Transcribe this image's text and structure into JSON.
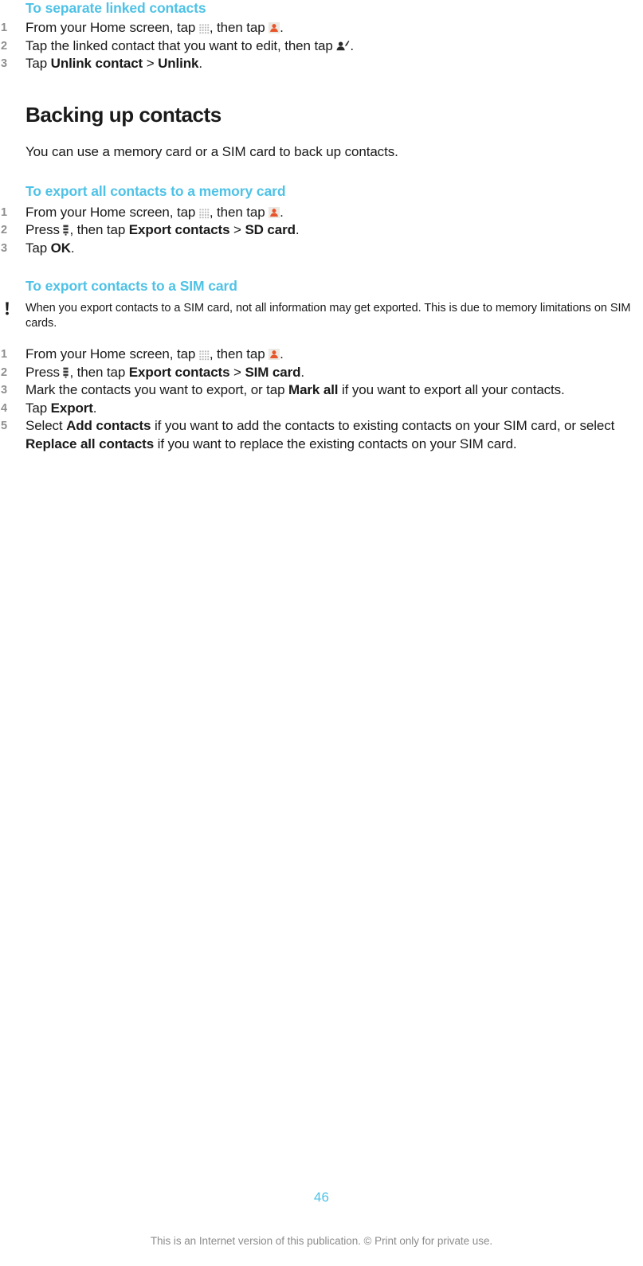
{
  "document": {
    "page_number": "46",
    "footer_text": "This is an Internet version of this publication. © Print only for private use.",
    "accent_color": "#4ec2e6",
    "text_color": "#1a1a1a",
    "number_color": "#8e8e8e"
  },
  "sections": [
    {
      "id": "separate-linked-contacts",
      "heading": "To separate linked contacts",
      "steps": [
        {
          "number": "1",
          "parts": [
            {
              "type": "text",
              "value": "From your Home screen, tap "
            },
            {
              "type": "icon",
              "name": "app-grid-icon"
            },
            {
              "type": "text",
              "value": ", then tap "
            },
            {
              "type": "icon",
              "name": "contacts-icon"
            },
            {
              "type": "text",
              "value": "."
            }
          ]
        },
        {
          "number": "2",
          "parts": [
            {
              "type": "text",
              "value": "Tap the linked contact that you want to edit, then tap "
            },
            {
              "type": "icon",
              "name": "edit-contact-icon"
            },
            {
              "type": "text",
              "value": "."
            }
          ]
        },
        {
          "number": "3",
          "parts": [
            {
              "type": "text",
              "value": "Tap "
            },
            {
              "type": "bold",
              "value": "Unlink contact"
            },
            {
              "type": "text",
              "value": " > "
            },
            {
              "type": "bold",
              "value": "Unlink"
            },
            {
              "type": "text",
              "value": "."
            }
          ]
        }
      ]
    },
    {
      "id": "backing-up-contacts",
      "heading": "Backing up contacts",
      "intro": "You can use a memory card or a SIM card to back up contacts."
    },
    {
      "id": "export-all-to-memory-card",
      "heading": "To export all contacts to a memory card",
      "steps": [
        {
          "number": "1",
          "parts": [
            {
              "type": "text",
              "value": "From your Home screen, tap "
            },
            {
              "type": "icon",
              "name": "app-grid-icon"
            },
            {
              "type": "text",
              "value": ", then tap "
            },
            {
              "type": "icon",
              "name": "contacts-icon"
            },
            {
              "type": "text",
              "value": "."
            }
          ]
        },
        {
          "number": "2",
          "parts": [
            {
              "type": "text",
              "value": "Press "
            },
            {
              "type": "icon",
              "name": "menu-icon"
            },
            {
              "type": "text",
              "value": ", then tap "
            },
            {
              "type": "bold",
              "value": "Export contacts"
            },
            {
              "type": "text",
              "value": " > "
            },
            {
              "type": "bold",
              "value": "SD card"
            },
            {
              "type": "text",
              "value": "."
            }
          ]
        },
        {
          "number": "3",
          "parts": [
            {
              "type": "text",
              "value": "Tap "
            },
            {
              "type": "bold",
              "value": "OK"
            },
            {
              "type": "text",
              "value": "."
            }
          ]
        }
      ]
    },
    {
      "id": "export-to-sim-card",
      "heading": "To export contacts to a SIM card",
      "note": "When you export contacts to a SIM card, not all information may get exported. This is due to memory limitations on SIM cards.",
      "note_icon": "exclamation-icon",
      "steps": [
        {
          "number": "1",
          "parts": [
            {
              "type": "text",
              "value": "From your Home screen, tap "
            },
            {
              "type": "icon",
              "name": "app-grid-icon"
            },
            {
              "type": "text",
              "value": ", then tap "
            },
            {
              "type": "icon",
              "name": "contacts-icon"
            },
            {
              "type": "text",
              "value": "."
            }
          ]
        },
        {
          "number": "2",
          "parts": [
            {
              "type": "text",
              "value": "Press "
            },
            {
              "type": "icon",
              "name": "menu-icon"
            },
            {
              "type": "text",
              "value": ", then tap "
            },
            {
              "type": "bold",
              "value": "Export contacts"
            },
            {
              "type": "text",
              "value": " > "
            },
            {
              "type": "bold",
              "value": "SIM card"
            },
            {
              "type": "text",
              "value": "."
            }
          ]
        },
        {
          "number": "3",
          "parts": [
            {
              "type": "text",
              "value": "Mark the contacts you want to export, or tap "
            },
            {
              "type": "bold",
              "value": "Mark all"
            },
            {
              "type": "text",
              "value": " if you want to export all your contacts."
            }
          ]
        },
        {
          "number": "4",
          "parts": [
            {
              "type": "text",
              "value": "Tap "
            },
            {
              "type": "bold",
              "value": "Export"
            },
            {
              "type": "text",
              "value": "."
            }
          ]
        },
        {
          "number": "5",
          "parts": [
            {
              "type": "text",
              "value": "Select "
            },
            {
              "type": "bold",
              "value": "Add contacts"
            },
            {
              "type": "text",
              "value": " if you want to add the contacts to existing contacts on your SIM card, or select "
            },
            {
              "type": "bold",
              "value": "Replace all contacts"
            },
            {
              "type": "text",
              "value": " if you want to replace the existing contacts on your SIM card."
            }
          ]
        }
      ]
    }
  ]
}
